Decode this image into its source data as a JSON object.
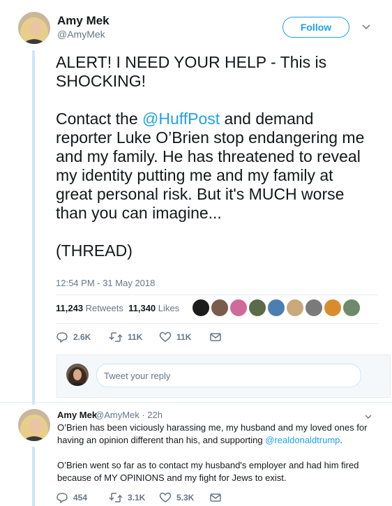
{
  "tweet": {
    "author_name": "Amy Mek",
    "author_handle": "@AmyMek",
    "follow_label": "Follow",
    "text_line1": "ALERT! I NEED YOUR HELP - This is SHOCKING!",
    "text_contact_pre": "Contact the ",
    "text_mention": "@HuffPost",
    "text_contact_post": " and demand reporter Luke O’Brien stop endangering me and my family. He has threatened to reveal my identity putting me and my family at great personal risk. But it's MUCH worse than you can imagine...",
    "text_thread": "(THREAD)",
    "timestamp": "12:54 PM - 31 May 2018",
    "retweets_count": "11,243",
    "retweets_label": "Retweets",
    "likes_count": "11,340",
    "likes_label": "Likes",
    "reply_count": "2.6K",
    "retweet_count_short": "11K",
    "like_count_short": "11K"
  },
  "reply_composer": {
    "placeholder": "Tweet your reply"
  },
  "reply": {
    "author_name": "Amy Mek",
    "author_handle_time": "@AmyMek · 22h",
    "para1_pre": "O’Brien has been viciously harassing me, my husband and my loved ones for having an opinion different than his, and supporting ",
    "para1_mention": "@realdonaldtrump",
    "para1_post": ".",
    "para2": "O’Brien went so far as to contact my husband's employer and had him fired because of MY OPINIONS and my fight for Jews to exist.",
    "reply_count": "454",
    "retweet_count": "3.1K",
    "like_count": "5.3K"
  },
  "colors": {
    "accent": "#1da1f2",
    "muted": "#657786",
    "thread_line": "#cce6f7"
  }
}
